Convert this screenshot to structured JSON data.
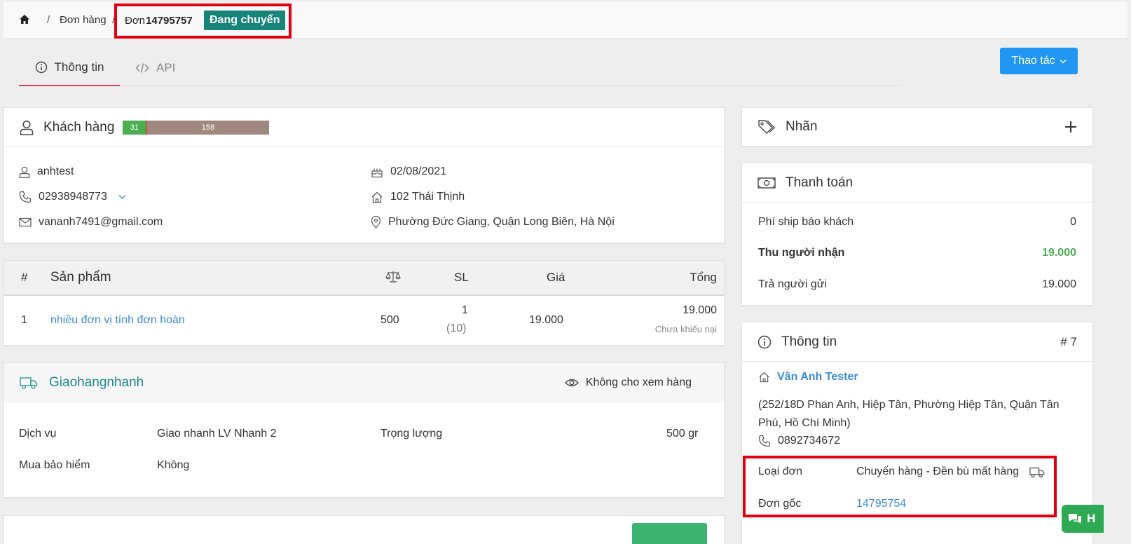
{
  "breadcrumb": {
    "orders": "Đơn hàng",
    "order_prefix": "Đơn",
    "order_no": "14795757",
    "status": "Đang chuyển"
  },
  "tabs": [
    {
      "label": "Thông tin",
      "active": true
    },
    {
      "label": "API",
      "active": false
    }
  ],
  "action_button": "Thao tác",
  "customer": {
    "title": "Khách hàng",
    "bar_green": "31",
    "bar_brown": "158",
    "name": "anhtest",
    "phone": "02938948773",
    "email": "vananh7491@gmail.com",
    "birthday": "02/08/2021",
    "address": "102 Thái Thịnh",
    "area": "Phường Đức Giang, Quận Long Biên, Hà Nội"
  },
  "products": {
    "headers": {
      "no": "#",
      "name": "Sản phẩm",
      "sl": "SL",
      "price": "Giá",
      "total": "Tổng"
    },
    "rows": [
      {
        "no": "1",
        "name": "nhiều đơn vị tính đơn hoàn",
        "weight": "500",
        "qty": "1",
        "qty_sub": "(10)",
        "price": "19.000",
        "total": "19.000",
        "note": "Chưa khiếu nại"
      }
    ]
  },
  "shipping": {
    "carrier": "Giaohangnhanh",
    "view_policy": "Không cho xem hàng",
    "service_label": "Dịch vụ",
    "service_value": "Giao nhanh LV Nhanh 2",
    "weight_label": "Trọng lượng",
    "weight_value": "500 gr",
    "insurance_label": "Mua bảo hiểm",
    "insurance_value": "Không"
  },
  "labels": {
    "title": "Nhãn"
  },
  "payment": {
    "title": "Thanh toán",
    "rows": [
      {
        "label": "Phí ship báo khách",
        "value": "0"
      },
      {
        "label": "Thu người nhận",
        "value": "19.000"
      },
      {
        "label": "Trả người gửi",
        "value": "19.000"
      }
    ]
  },
  "info": {
    "title": "Thông tin",
    "number": "# 7",
    "shop_name": "Vân Anh Tester",
    "shop_address": "(252/18D Phan Anh, Hiệp Tân, Phường Hiệp Tân, Quận Tân Phú, Hồ Chí Minh)",
    "shop_phone": "0892734672",
    "type_label": "Loại đơn",
    "type_value": "Chuyển hàng - Đền bù mất hàng",
    "origin_label": "Đơn gốc",
    "origin_value": "14795754"
  },
  "chat_label": "H",
  "colors": {
    "status": "#17847a",
    "accent": "#2196f3",
    "link": "#3b8bd4",
    "green": "#4caf50",
    "highlight": "#e3000f"
  }
}
